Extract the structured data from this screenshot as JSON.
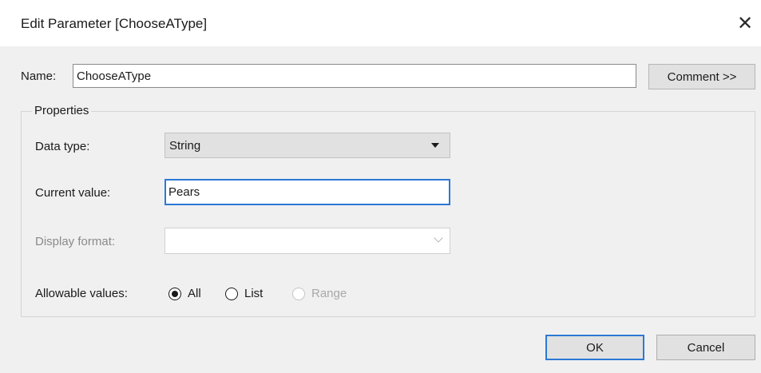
{
  "window": {
    "title": "Edit Parameter [ChooseAType]",
    "close_icon": "close-icon",
    "close_glyph": "✕"
  },
  "name": {
    "label": "Name:",
    "value": "ChooseAType"
  },
  "comment_button": {
    "label": "Comment >>"
  },
  "properties": {
    "legend": "Properties",
    "data_type": {
      "label": "Data type:",
      "value": "String"
    },
    "current_value": {
      "label": "Current value:",
      "value": "Pears"
    },
    "display_format": {
      "label": "Display format:",
      "value": "",
      "enabled": false
    },
    "allowable_values": {
      "label": "Allowable values:",
      "options": [
        {
          "label": "All",
          "selected": true,
          "enabled": true
        },
        {
          "label": "List",
          "selected": false,
          "enabled": true
        },
        {
          "label": "Range",
          "selected": false,
          "enabled": false
        }
      ]
    }
  },
  "footer": {
    "ok_label": "OK",
    "cancel_label": "Cancel"
  },
  "colors": {
    "accent": "#2b79d6",
    "dialog_bg": "#f0f0f0",
    "button_bg": "#e1e1e1"
  }
}
